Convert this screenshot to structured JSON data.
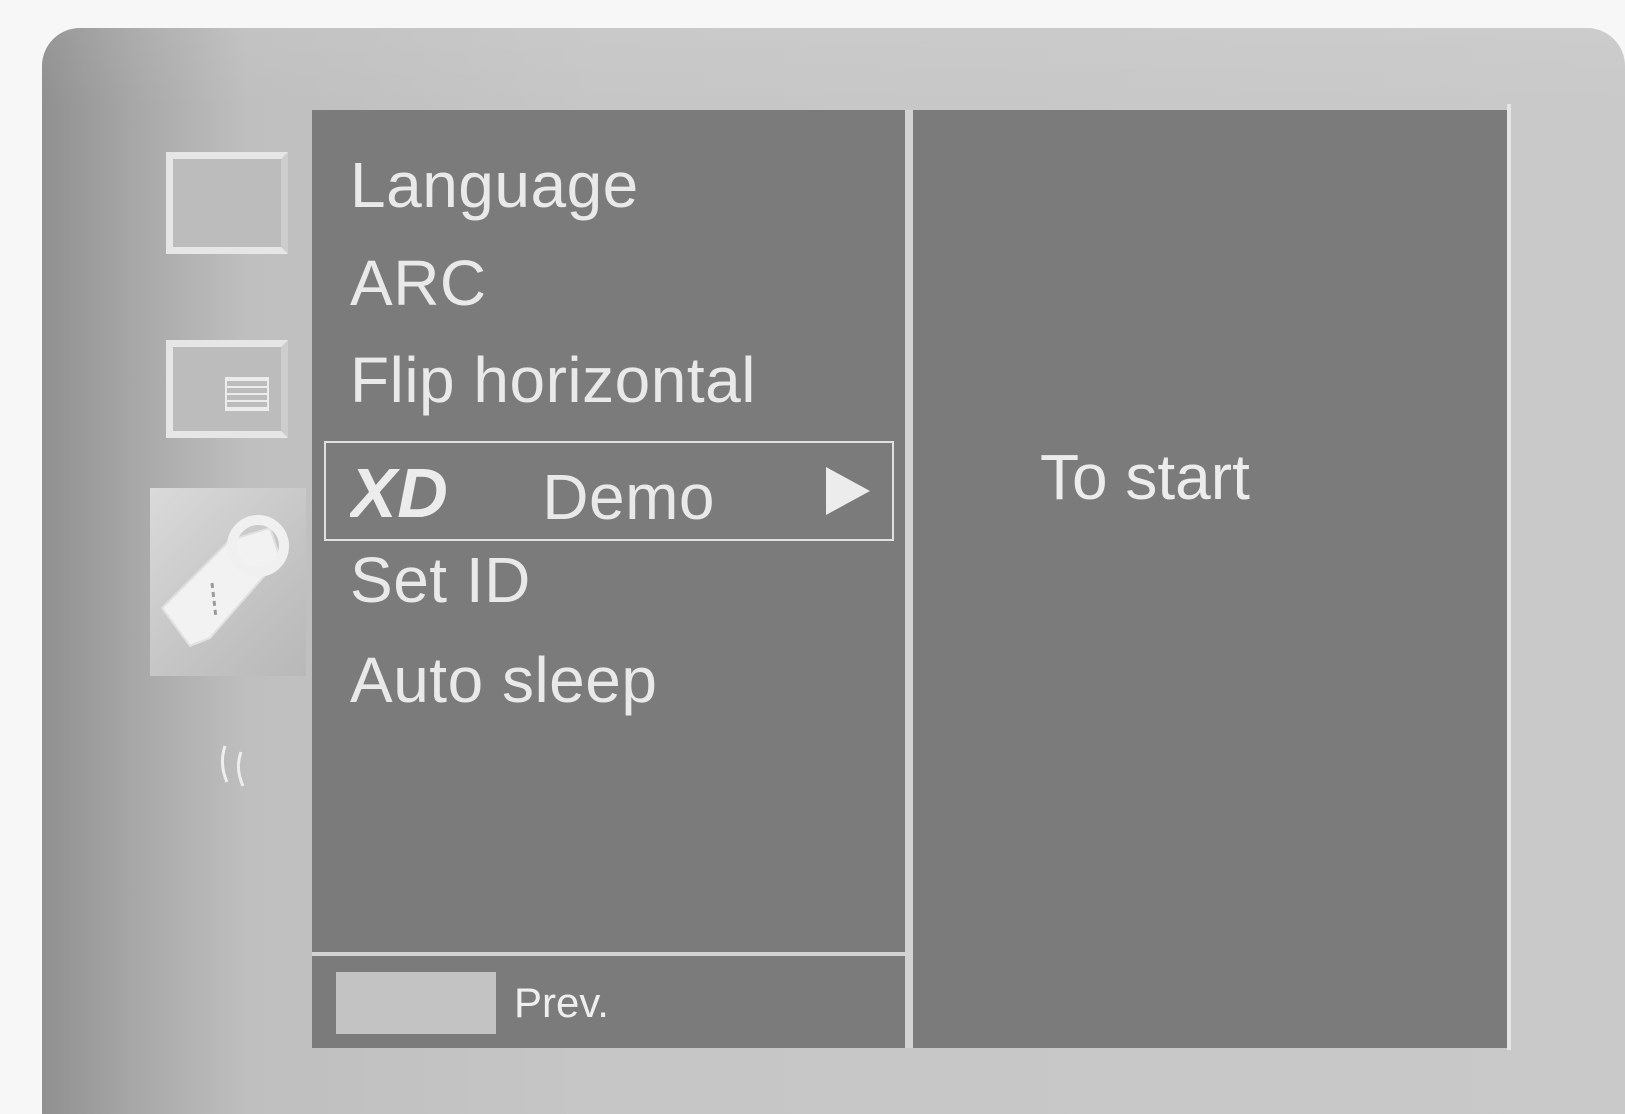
{
  "menu": {
    "items": [
      {
        "label": "Language",
        "selected": false
      },
      {
        "label": "ARC",
        "selected": false
      },
      {
        "label": "Flip horizontal",
        "selected": false
      },
      {
        "label": "Demo",
        "logo": "XD",
        "selected": true
      },
      {
        "label": "Set ID",
        "selected": false
      },
      {
        "label": "Auto sleep",
        "selected": false
      }
    ]
  },
  "footer": {
    "prev_label": "Prev."
  },
  "detail": {
    "hint": "To start"
  },
  "icons": {
    "side": [
      "screen-icon",
      "menu-list-icon",
      "option-tool-icon",
      "sound-icon"
    ],
    "submenu_arrow": "triangle-right-icon"
  },
  "colors": {
    "panel": "#7b7b7b",
    "frame": "#c6c6c6",
    "text": "#e9e9e9"
  }
}
